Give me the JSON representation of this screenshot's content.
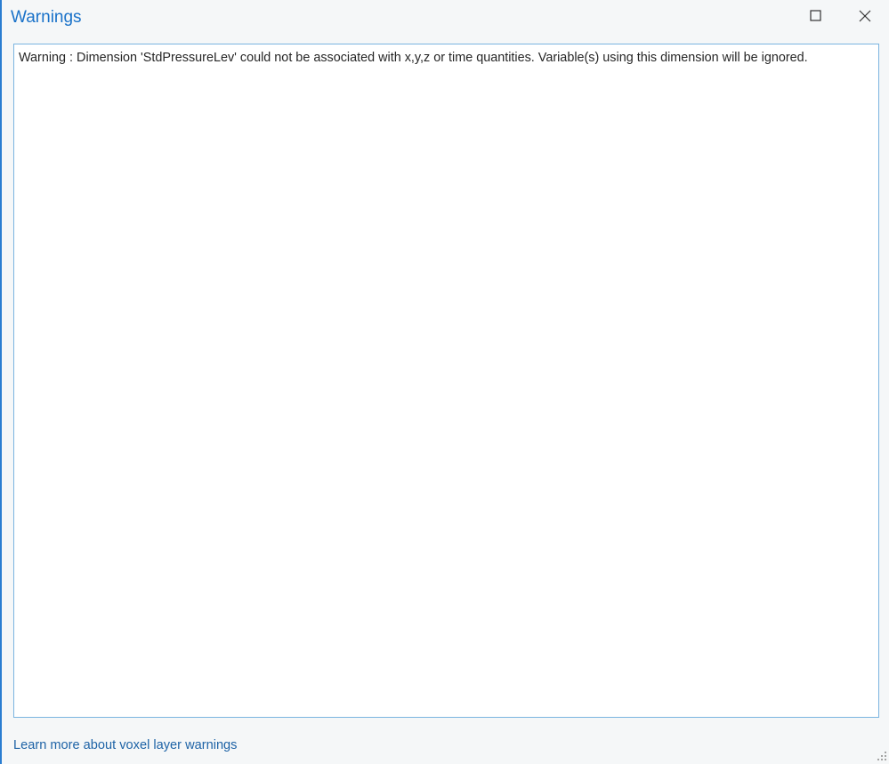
{
  "window": {
    "title": "Warnings",
    "accent_color": "#1a72c9"
  },
  "title_bar": {
    "buttons": [
      {
        "name": "maximize",
        "icon": "maximize-icon"
      },
      {
        "name": "close",
        "icon": "close-icon"
      }
    ]
  },
  "warnings": {
    "messages": [
      "Warning : Dimension 'StdPressureLev' could not be associated with x,y,z or time quantities. Variable(s) using this dimension will be ignored."
    ]
  },
  "footer": {
    "link_label": "Learn more about voxel layer warnings",
    "link_color": "#1e63a6"
  },
  "resize_grip": {
    "icon": "resize-grip-icon"
  }
}
